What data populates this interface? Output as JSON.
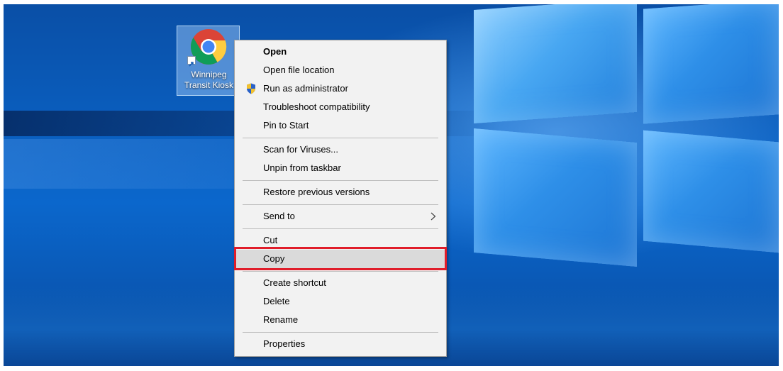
{
  "desktop": {
    "icon": {
      "name": "chrome-shortcut",
      "label_line1": "Winnipeg",
      "label_line2": "Transit Kiosk"
    }
  },
  "context_menu": {
    "items": [
      {
        "label": "Open",
        "bold": true
      },
      {
        "label": "Open file location"
      },
      {
        "label": "Run as administrator",
        "icon": "shield-icon"
      },
      {
        "label": "Troubleshoot compatibility"
      },
      {
        "label": "Pin to Start"
      },
      {
        "label": "Scan for Viruses..."
      },
      {
        "label": "Unpin from taskbar"
      },
      {
        "label": "Restore previous versions"
      },
      {
        "label": "Send to",
        "icon": "chevron-right-icon"
      },
      {
        "label": "Cut"
      },
      {
        "label": "Copy",
        "highlighted": true
      },
      {
        "label": "Create shortcut"
      },
      {
        "label": "Delete"
      },
      {
        "label": "Rename"
      },
      {
        "label": "Properties"
      }
    ]
  },
  "colors": {
    "highlight_border": "#e01d2a",
    "menu_background": "#f2f2f2",
    "selected_item": "#dadada",
    "desktop_blue": "#0b67cc"
  }
}
